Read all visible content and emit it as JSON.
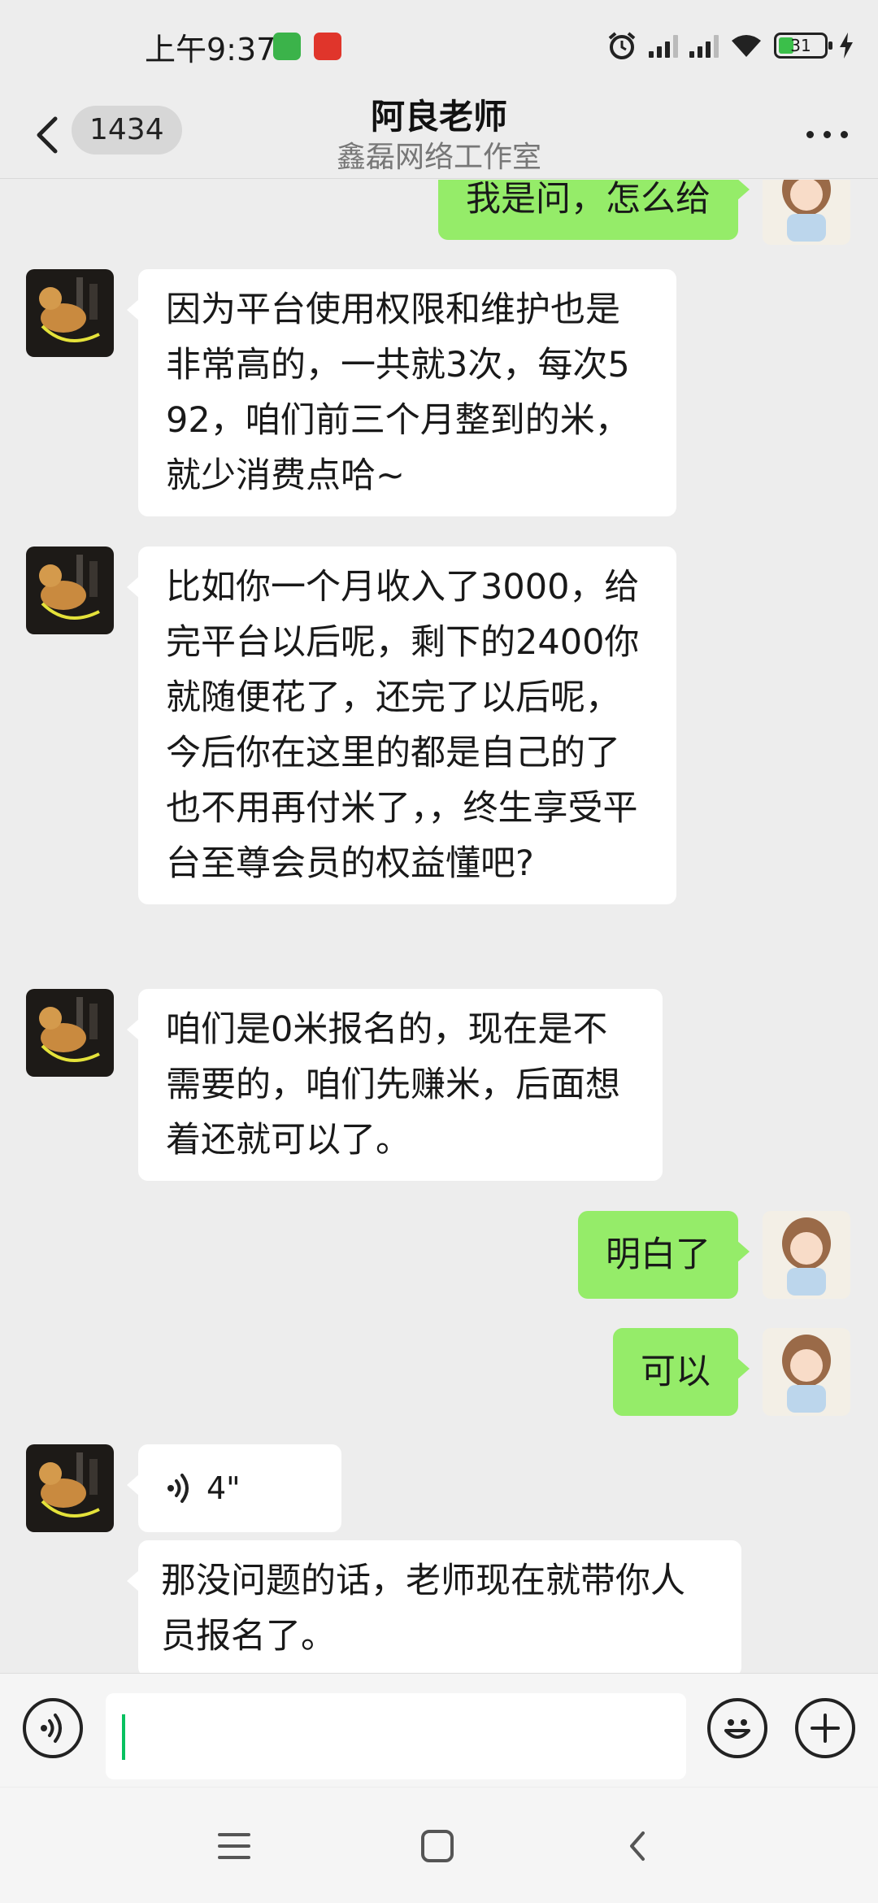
{
  "status_bar": {
    "time": "上午9:37",
    "battery_level": "31",
    "icons": [
      "alarm-icon",
      "signal-icon",
      "signal-icon",
      "wifi-icon",
      "battery-icon",
      "charging-icon"
    ]
  },
  "header": {
    "back_icon": "chevron-left-icon",
    "unread_count": "1434",
    "title": "阿良老师",
    "subtitle": "鑫磊网络工作室",
    "more_icon": "more-dots-icon"
  },
  "messages": [
    {
      "side": "out",
      "text": "我是问，怎么给"
    },
    {
      "side": "in",
      "text": "因为平台使用权限和维护也是非常高的，一共就3次，每次592，咱们前三个月整到的米，就少消费点哈~"
    },
    {
      "side": "in",
      "text": "比如你一个月收入了3000，给完平台以后呢，剩下的2400你就随便花了，还完了以后呢，今后你在这里的都是自己的了也不用再付米了，，终生享受平台至尊会员的权益懂吧?"
    },
    {
      "side": "in",
      "text": "咱们是0米报名的，现在是不需要的，咱们先赚米，后面想着还就可以了。"
    },
    {
      "side": "out",
      "text": "明白了"
    },
    {
      "side": "out",
      "text": "可以"
    },
    {
      "side": "in",
      "type": "voice",
      "duration": "4\""
    },
    {
      "side": "in",
      "text": "那没问题的话，老师现在就带你人员报名了。"
    }
  ],
  "input_bar": {
    "voice_icon": "voice-icon",
    "input_value": "",
    "emoji_icon": "emoji-icon",
    "plus_icon": "plus-icon"
  },
  "system_nav": {
    "icons": [
      "menu-icon",
      "home-icon",
      "back-icon"
    ]
  },
  "colors": {
    "background": "#ededed",
    "outgoing_bubble": "#95ec69",
    "incoming_bubble": "#ffffff",
    "accent": "#07c160"
  }
}
